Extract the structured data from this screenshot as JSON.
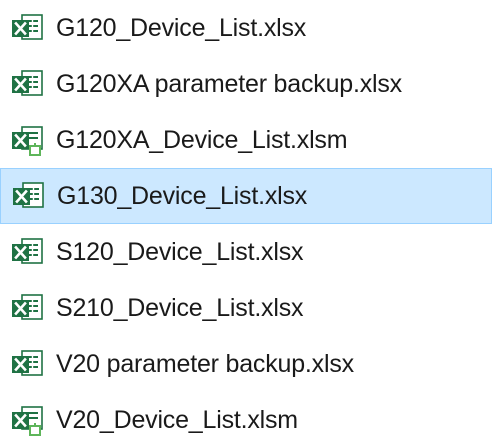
{
  "files": [
    {
      "name": "G120_Device_List.xlsx",
      "icon": "excel-xlsx-icon",
      "selected": false
    },
    {
      "name": "G120XA parameter backup.xlsx",
      "icon": "excel-xlsx-icon",
      "selected": false
    },
    {
      "name": "G120XA_Device_List.xlsm",
      "icon": "excel-xlsm-icon",
      "selected": false
    },
    {
      "name": "G130_Device_List.xlsx",
      "icon": "excel-xlsx-icon",
      "selected": true
    },
    {
      "name": "S120_Device_List.xlsx",
      "icon": "excel-xlsx-icon",
      "selected": false
    },
    {
      "name": "S210_Device_List.xlsx",
      "icon": "excel-xlsx-icon",
      "selected": false
    },
    {
      "name": "V20 parameter backup.xlsx",
      "icon": "excel-xlsx-icon",
      "selected": false
    },
    {
      "name": "V20_Device_List.xlsm",
      "icon": "excel-xlsm-icon",
      "selected": false
    }
  ],
  "colors": {
    "selection_background": "#cce8ff",
    "selection_border": "#99d1ff",
    "excel_green": "#1f7244",
    "excel_light_green": "#5eb55a"
  }
}
